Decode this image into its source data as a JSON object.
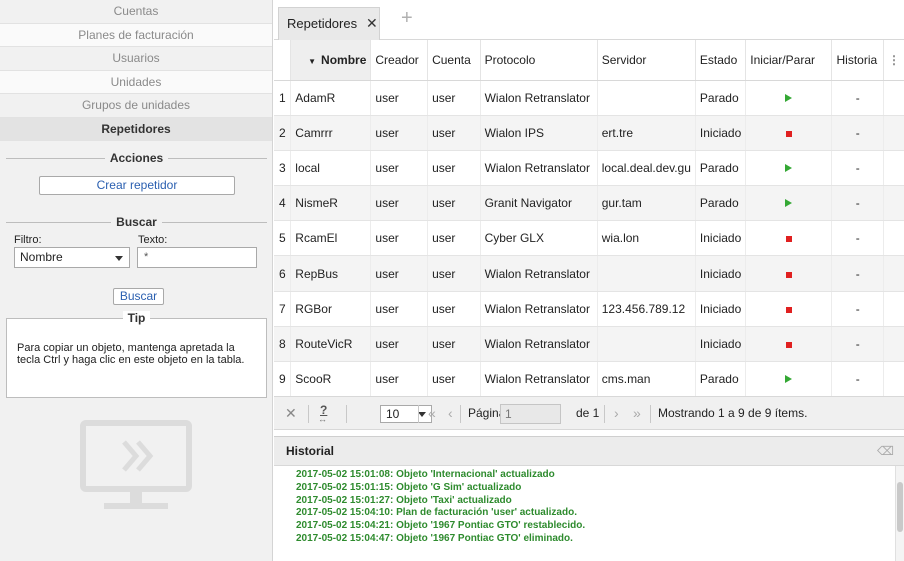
{
  "sidebar": {
    "nav": [
      {
        "label": "Cuentas"
      },
      {
        "label": "Planes de facturación"
      },
      {
        "label": "Usuarios"
      },
      {
        "label": "Unidades"
      },
      {
        "label": "Grupos de unidades"
      },
      {
        "label": "Repetidores"
      }
    ],
    "acciones": {
      "title": "Acciones",
      "crear_label": "Crear repetidor"
    },
    "buscar": {
      "title": "Buscar",
      "filtro_label": "Filtro:",
      "texto_label": "Texto:",
      "filtro_value": "Nombre",
      "texto_value": "*",
      "button_label": "Buscar"
    },
    "tip": {
      "title": "Tip",
      "text": "Para copiar un objeto, mantenga apretada la tecla Ctrl y haga clic en este objeto en la tabla."
    }
  },
  "tabs": {
    "active_label": "Repetidores",
    "close_glyph": "✕",
    "add_glyph": "+"
  },
  "table": {
    "columns": [
      "",
      "Nombre",
      "Creador",
      "Cuenta",
      "Protocolo",
      "Servidor",
      "Estado",
      "Iniciar/Parar",
      "Historia"
    ],
    "sort_glyph": "▼",
    "rows": [
      {
        "n": "1",
        "nombre": "AdamR",
        "creador": "user",
        "cuenta": "user",
        "protocolo": "Wialon Retranslator",
        "servidor": "",
        "estado": "Parado",
        "action": "play",
        "historia": "-"
      },
      {
        "n": "2",
        "nombre": "Camrrr",
        "creador": "user",
        "cuenta": "user",
        "protocolo": "Wialon IPS",
        "servidor": "ert.tre",
        "estado": "Iniciado",
        "action": "stop",
        "historia": "-"
      },
      {
        "n": "3",
        "nombre": "local",
        "creador": "user",
        "cuenta": "user",
        "protocolo": "Wialon Retranslator",
        "servidor": "local.deal.dev.gu",
        "estado": "Parado",
        "action": "play",
        "historia": "-"
      },
      {
        "n": "4",
        "nombre": "NismeR",
        "creador": "user",
        "cuenta": "user",
        "protocolo": "Granit Navigator",
        "servidor": "gur.tam",
        "estado": "Parado",
        "action": "play",
        "historia": "-"
      },
      {
        "n": "5",
        "nombre": "RcamEl",
        "creador": "user",
        "cuenta": "user",
        "protocolo": "Cyber GLX",
        "servidor": "wia.lon",
        "estado": "Iniciado",
        "action": "stop",
        "historia": "-"
      },
      {
        "n": "6",
        "nombre": "RepBus",
        "creador": "user",
        "cuenta": "user",
        "protocolo": "Wialon Retranslator",
        "servidor": "",
        "estado": "Iniciado",
        "action": "stop",
        "historia": "-"
      },
      {
        "n": "7",
        "nombre": "RGBor",
        "creador": "user",
        "cuenta": "user",
        "protocolo": "Wialon Retranslator",
        "servidor": "123.456.789.12",
        "estado": "Iniciado",
        "action": "stop",
        "historia": "-"
      },
      {
        "n": "8",
        "nombre": "RouteVicR",
        "creador": "user",
        "cuenta": "user",
        "protocolo": "Wialon Retranslator",
        "servidor": "",
        "estado": "Iniciado",
        "action": "stop",
        "historia": "-"
      },
      {
        "n": "9",
        "nombre": "ScooR",
        "creador": "user",
        "cuenta": "user",
        "protocolo": "Wialon Retranslator",
        "servidor": "cms.man",
        "estado": "Parado",
        "action": "play",
        "historia": "-"
      }
    ]
  },
  "pager": {
    "page_size": "10",
    "page_label": "Página",
    "page_value": "1",
    "of_label": "de 1",
    "showing": "Mostrando 1 a 9 de 9 ítems.",
    "help_glyph": "?",
    "first_glyph": "«",
    "prev_glyph": "‹",
    "next_glyph": "›",
    "last_glyph": "»",
    "clear_glyph": "✕"
  },
  "historial": {
    "title": "Historial",
    "log": [
      "2017-05-02 15:01:08: Objeto 'Internacional' actualizado",
      "2017-05-02 15:01:15: Objeto 'G Sim' actualizado",
      "2017-05-02 15:01:27: Objeto 'Taxi' actualizado",
      "2017-05-02 15:04:10: Plan de facturación 'user' actualizado.",
      "2017-05-02 15:04:21: Objeto '1967 Pontiac GTO' restablecido.",
      "2017-05-02 15:04:47: Objeto '1967 Pontiac GTO' eliminado."
    ]
  },
  "colors": {
    "play": "#34a834",
    "stop": "#e02020",
    "log_text": "#2e8b2e",
    "link": "#2a5fb0"
  }
}
